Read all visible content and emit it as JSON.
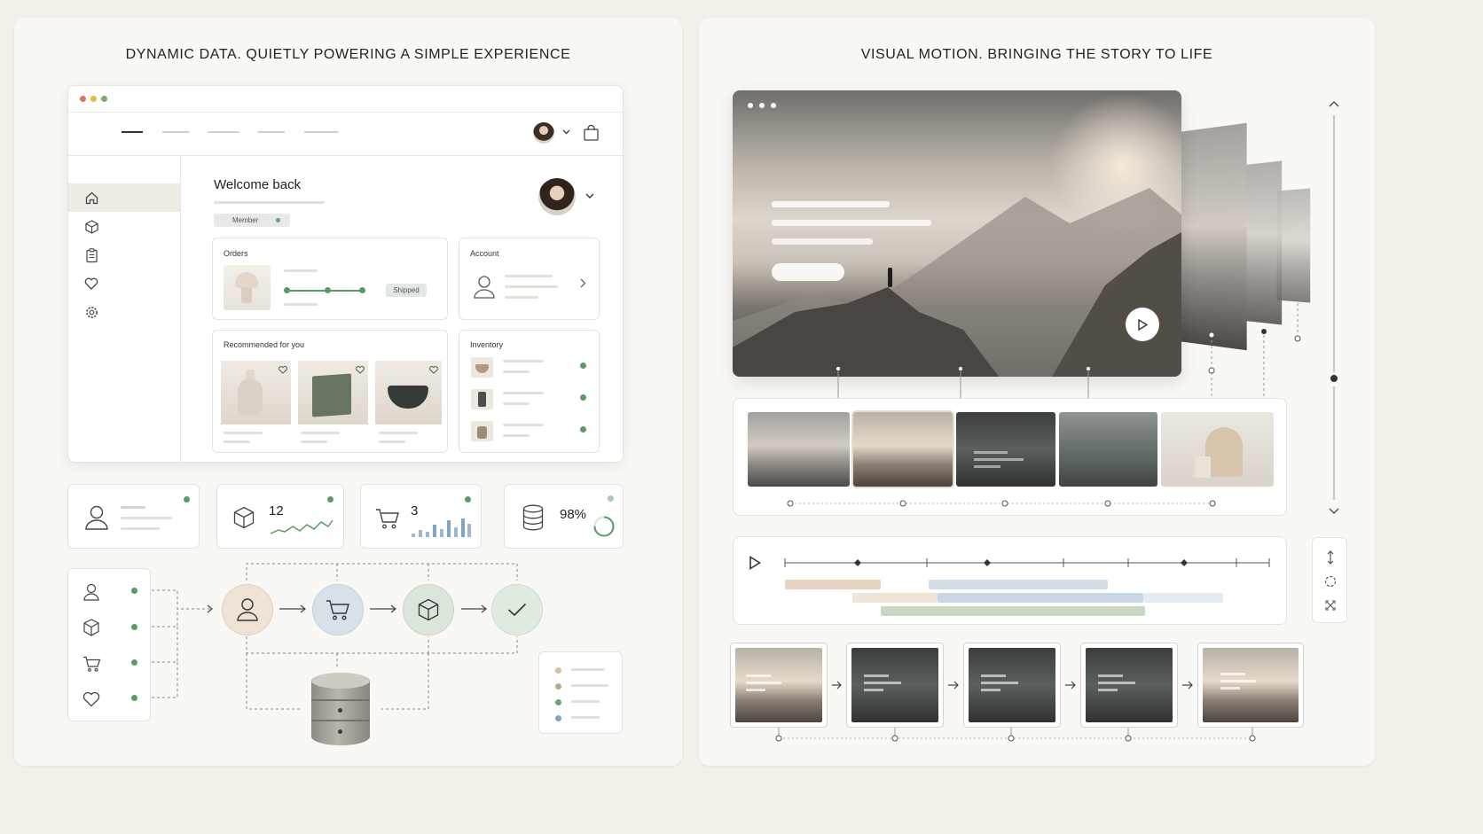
{
  "left_panel": {
    "title": "DYNAMIC DATA. QUIETLY POWERING A SIMPLE EXPERIENCE",
    "dashboard": {
      "welcome": "Welcome back",
      "badge": "Member",
      "orders": {
        "title": "Orders",
        "status": "Shipped"
      },
      "account": {
        "title": "Account"
      },
      "recommended": {
        "title": "Recommended for you"
      },
      "inventory": {
        "title": "Inventory"
      }
    },
    "stats": [
      {
        "value": ""
      },
      {
        "value": "12"
      },
      {
        "value": "3"
      },
      {
        "value": "98%"
      }
    ],
    "progress_ring": 0.75
  },
  "right_panel": {
    "title": "VISUAL MOTION. BRINGING THE STORY TO LIFE"
  },
  "icons": [
    "home-icon",
    "box-icon",
    "clipboard-icon",
    "heart-icon",
    "gear-icon",
    "user-icon",
    "cart-icon",
    "database-icon",
    "check-icon",
    "play-icon",
    "bag-icon",
    "chevron-down-icon",
    "chevron-right-icon"
  ],
  "colors": {
    "accent_green": "#5a9a67",
    "accent_blue": "#7fa6c6",
    "accent_tan": "#d8bfa2",
    "bg": "#f3f0ea"
  }
}
